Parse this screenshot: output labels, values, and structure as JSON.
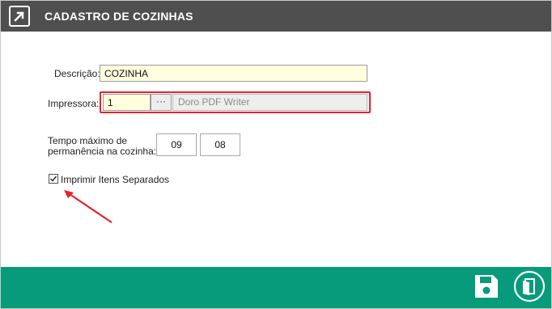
{
  "window": {
    "title": "CADASTRO DE COZINHAS"
  },
  "form": {
    "descricao_label": "Descrição:",
    "descricao_value": "COZINHA",
    "impressora_label": "Impressora:",
    "impressora_code": "1",
    "impressora_lookup_label": "···",
    "impressora_name": "Doro PDF Writer",
    "tempo_label_line1": "Tempo máximo de",
    "tempo_label_line2": "permanência na cozinha:",
    "tempo_hours": "09",
    "tempo_minutes": "08",
    "imprimir_label": "Imprimir Itens Separados",
    "imprimir_checked": true
  },
  "colors": {
    "titlebar": "#4f4f4f",
    "footer": "#079b7b",
    "highlight": "#e8212b",
    "input_bg": "#ffffe0"
  },
  "footer": {
    "icons": [
      "save-icon",
      "exit-icon"
    ]
  }
}
